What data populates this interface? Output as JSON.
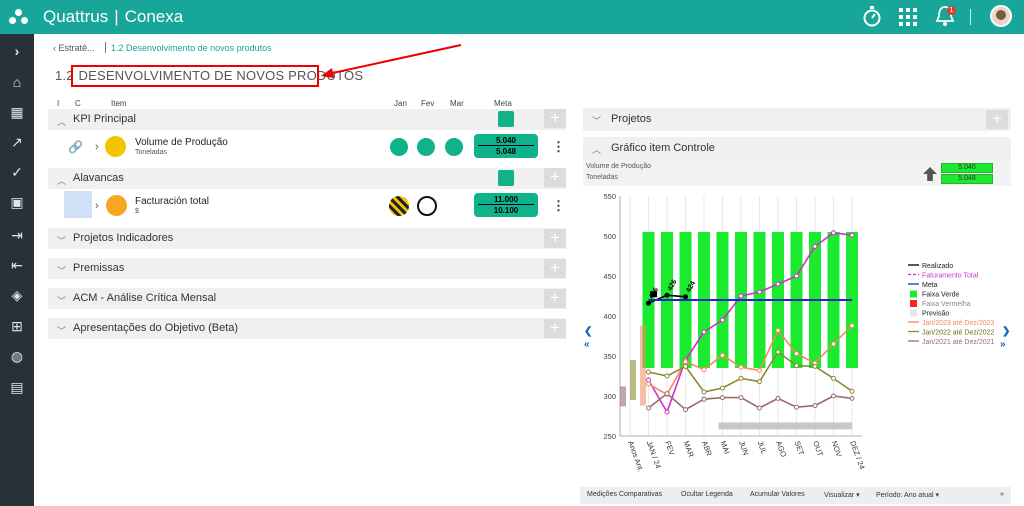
{
  "app": {
    "brand": "Quattrus",
    "module": "Conexa"
  },
  "topbar_icons": [
    "timer-icon",
    "apps-grid-icon",
    "bell-icon",
    "avatar"
  ],
  "notification_count": "1",
  "sidebar_icons": [
    "chevron-right-icon",
    "home-icon",
    "dashboard-icon",
    "trend-icon",
    "check-icon",
    "calendar-icon",
    "import-icon",
    "export-icon",
    "layers-icon",
    "hierarchy-icon",
    "globe-icon",
    "book-icon"
  ],
  "breadcrumb": {
    "back": "Estratê...",
    "current": "1.2 Desenvolvimento de novos produtos"
  },
  "page": {
    "number": "1.2",
    "title": "DESENVOLVIMENTO DE NOVOS PRODUTOS"
  },
  "columns": {
    "i": "I",
    "c": "C",
    "item": "Item",
    "jan": "Jan",
    "fev": "Fev",
    "mar": "Mar",
    "meta": "Meta"
  },
  "sections": {
    "kpi": "KPI Principal",
    "alavancas": "Alavancas",
    "projetos_ind": "Projetos Indicadores",
    "premissas": "Premissas",
    "acm": "ACM - Análise Crítica Mensal",
    "apresentacoes": "Apresentações do Objetivo (Beta)"
  },
  "kpi_row": {
    "name": "Volume de Produção",
    "unit": "Toneladas",
    "meta_top": "5.040",
    "meta_bottom": "5.048"
  },
  "alav_row": {
    "name": "Facturación total",
    "unit": "$",
    "meta_top": "11.000",
    "meta_bottom": "10.100"
  },
  "right": {
    "projetos": "Projetos",
    "grafico": "Gráfico item Controle",
    "info_name": "Volume de Produção",
    "info_unit": "Toneladas",
    "info_v1": "5.040",
    "info_v2": "5.048"
  },
  "footer": {
    "b1": "Medições Comparativas",
    "b2": "Ocultar Legenda",
    "b3": "Acumular Valores",
    "b4": "Visualizar ▾",
    "b5": "Período: Ano atual ▾",
    "more": "»"
  },
  "colors": {
    "brand": "#18a59a",
    "green": "#10b28a",
    "faixa_verde": "#1aeb2e"
  },
  "chart_data": {
    "type": "line",
    "ylim": [
      250,
      550
    ],
    "yticks": [
      250,
      300,
      350,
      400,
      450,
      500,
      550
    ],
    "categories": [
      "Anos Ant.",
      "JAN / 24",
      "FEV",
      "MAR",
      "ABR",
      "MAI",
      "JUN",
      "JUL",
      "AGO",
      "SET",
      "OUT",
      "NOV",
      "DEZ / 24"
    ],
    "faixa_verde": {
      "low": 335,
      "high": 505
    },
    "data_labels": [
      "416",
      "426",
      "424"
    ],
    "series": [
      {
        "name": "Realizado",
        "color": "#000000",
        "values": [
          null,
          416,
          426,
          424,
          null,
          null,
          null,
          null,
          null,
          null,
          null,
          null,
          null
        ]
      },
      {
        "name": "Faturamento Total",
        "color": "#cc33cc",
        "values": [
          null,
          320,
          280,
          345,
          380,
          395,
          425,
          430,
          440,
          450,
          487,
          504,
          501
        ]
      },
      {
        "name": "Meta",
        "color": "#2222cc",
        "values": [
          null,
          420,
          420,
          420,
          420,
          420,
          420,
          420,
          420,
          420,
          420,
          420,
          420
        ]
      },
      {
        "name": "Jan/2023 até Dez/2023",
        "color": "#f08a5d",
        "values": [
          null,
          315,
          302,
          343,
          333,
          351,
          336,
          332,
          382,
          353,
          341,
          365,
          388
        ]
      },
      {
        "name": "Jan/2022 até Dez/2022",
        "color": "#8a8a30",
        "values": [
          null,
          330,
          325,
          337,
          305,
          310,
          322,
          318,
          355,
          338,
          337,
          322,
          306
        ]
      },
      {
        "name": "Jan/2021 até Dez/2021",
        "color": "#9a6b70",
        "values": [
          null,
          285,
          303,
          283,
          296,
          298,
          298,
          285,
          297,
          286,
          288,
          300,
          297
        ]
      }
    ],
    "legend": [
      "Realizado",
      "Faturamento Total",
      "Meta",
      "Faixa Verde",
      "Faixa Vermelha",
      "Previsão",
      "Jan/2023 até Dez/2023",
      "Jan/2022 até Dez/2022",
      "Jan/2021 até Dez/2021"
    ],
    "legend_position": "right"
  }
}
